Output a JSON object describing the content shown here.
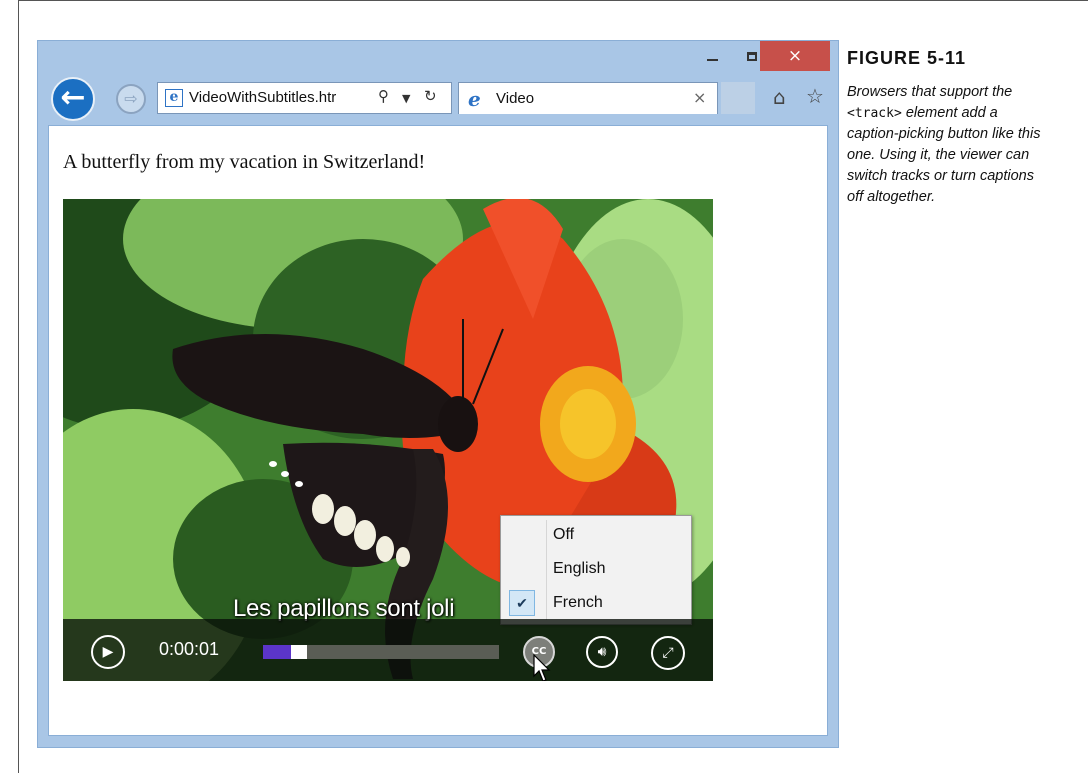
{
  "browser": {
    "address_url": "VideoWithSubtitles.htr",
    "tab_title": "Video",
    "minimize_label": "–",
    "close_label": "×",
    "tab_close_label": "×"
  },
  "page": {
    "text": "A butterfly from my vacation in Switzerland!"
  },
  "video": {
    "subtitle": "Les papillons sont joli",
    "time": "0:00:01",
    "progress_fraction": 0.12,
    "cc_label": "CC"
  },
  "caption_menu": {
    "items": [
      {
        "label": "Off",
        "checked": false
      },
      {
        "label": "English",
        "checked": false
      },
      {
        "label": "French",
        "checked": true
      }
    ]
  },
  "figure": {
    "title": "FIGURE 5-11",
    "caption_before": "Browsers that support the ",
    "caption_code": "<track>",
    "caption_after": " element add a caption-picking button like this one. Using it, the viewer can switch tracks or turn captions off altogether."
  },
  "colors": {
    "close_button": "#c7504a",
    "progress_fill": "#5b35c9",
    "back_button": "#1b6fc2"
  }
}
